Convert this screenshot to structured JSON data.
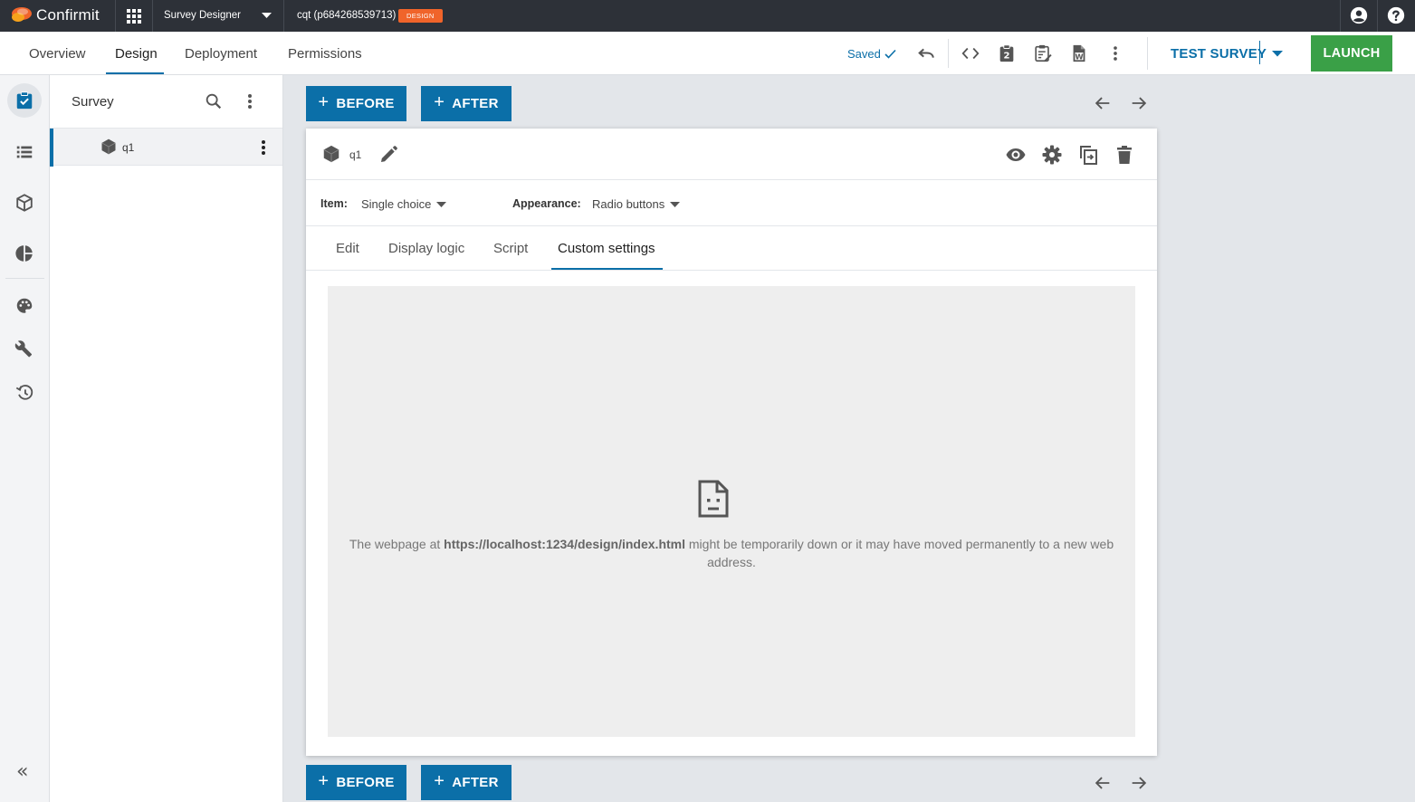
{
  "topbar": {
    "logo_text": "Confirmit",
    "app_name": "Survey Designer",
    "project_name": "cqt (p684268539713)",
    "badge": "DESIGN",
    "icons": [
      "apps-grid-icon",
      "account-icon",
      "help-icon"
    ]
  },
  "nav": {
    "tabs": [
      "Overview",
      "Design",
      "Deployment",
      "Permissions"
    ],
    "active_tab": "Design",
    "saved_label": "Saved",
    "test_survey_label": "TEST SURVEY",
    "launch_label": "LAUNCH"
  },
  "rail": {
    "items": [
      "survey-checklist-icon",
      "list-icon",
      "cube-icon",
      "pie-chart-icon",
      "palette-icon",
      "wrench-icon",
      "history-icon"
    ],
    "collapse_label": "«"
  },
  "tree": {
    "title": "Survey",
    "items": [
      {
        "label": "q1"
      }
    ]
  },
  "actions": {
    "before_label": "BEFORE",
    "after_label": "AFTER"
  },
  "question": {
    "name": "q1",
    "item_label": "Item:",
    "item_value": "Single choice",
    "appearance_label": "Appearance:",
    "appearance_value": "Radio buttons",
    "tabs": [
      "Edit",
      "Display logic",
      "Script",
      "Custom settings"
    ],
    "active_tab": "Custom settings"
  },
  "frame": {
    "error_prefix": "The webpage at ",
    "error_url": "https://localhost:1234/design/index.html",
    "error_suffix": " might be temporarily down or it may have moved permanently to a new web address."
  },
  "colors": {
    "topbar_bg": "#2d3138",
    "accent_blue": "#0b6fa8",
    "launch_green": "#3aa047",
    "badge_orange": "#f0642a",
    "canvas_bg": "#e3e6ea"
  }
}
